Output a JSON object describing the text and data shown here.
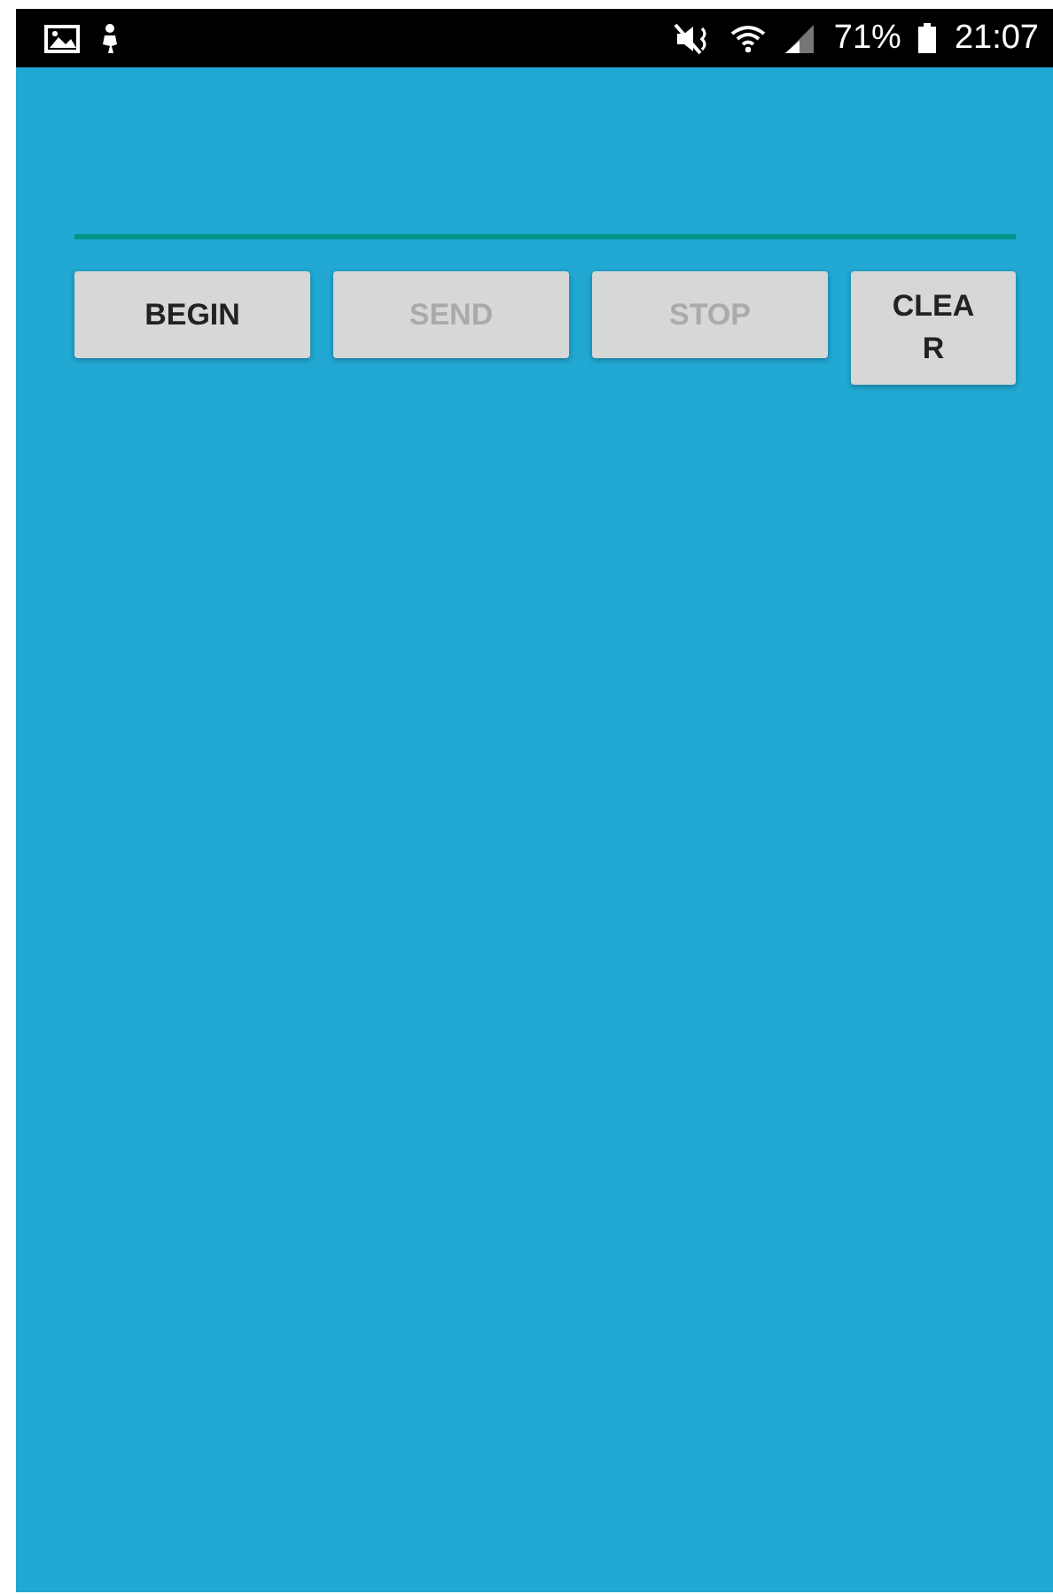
{
  "status_bar": {
    "battery": "71%",
    "time": "21:07"
  },
  "buttons": [
    {
      "label": "BEGIN",
      "disabled": false
    },
    {
      "label": "SEND",
      "disabled": true
    },
    {
      "label": "STOP",
      "disabled": true
    },
    {
      "label": "CLEAR",
      "disabled": false
    }
  ]
}
